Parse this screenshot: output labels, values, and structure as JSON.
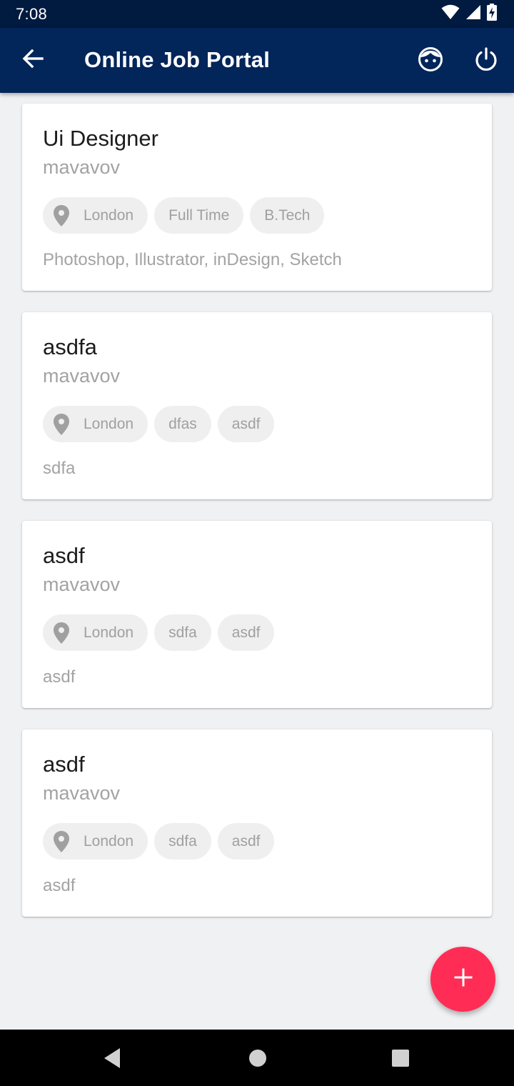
{
  "status_bar": {
    "time": "7:08",
    "icons": [
      "wifi-icon",
      "cell-signal-icon",
      "battery-charging-icon"
    ]
  },
  "app_bar": {
    "title": "Online Job Portal",
    "icons": [
      "arrow-back-icon",
      "face-icon",
      "power-icon"
    ]
  },
  "jobs": [
    {
      "title": "Ui Designer",
      "company": "mavavov",
      "location": "London",
      "type": "Full Time",
      "qualification": "B.Tech",
      "skills": "Photoshop, Illustrator, inDesign, Sketch"
    },
    {
      "title": "asdfa",
      "company": "mavavov",
      "location": "London",
      "type": "dfas",
      "qualification": "asdf",
      "skills": "sdfa"
    },
    {
      "title": "asdf",
      "company": "mavavov",
      "location": "London",
      "type": "sdfa",
      "qualification": "asdf",
      "skills": "asdf"
    },
    {
      "title": "asdf",
      "company": "mavavov",
      "location": "London",
      "type": "sdfa",
      "qualification": "asdf",
      "skills": "asdf"
    }
  ],
  "fab": {
    "icon": "plus-icon",
    "color": "#ff2d55"
  },
  "nav_bar": {
    "icons": [
      "nav-back-icon",
      "nav-home-icon",
      "nav-recents-icon"
    ]
  },
  "colors": {
    "app_bar": "#02255a",
    "status_bar": "#001a40",
    "background": "#f0f1f3",
    "accent": "#ff2d55"
  }
}
